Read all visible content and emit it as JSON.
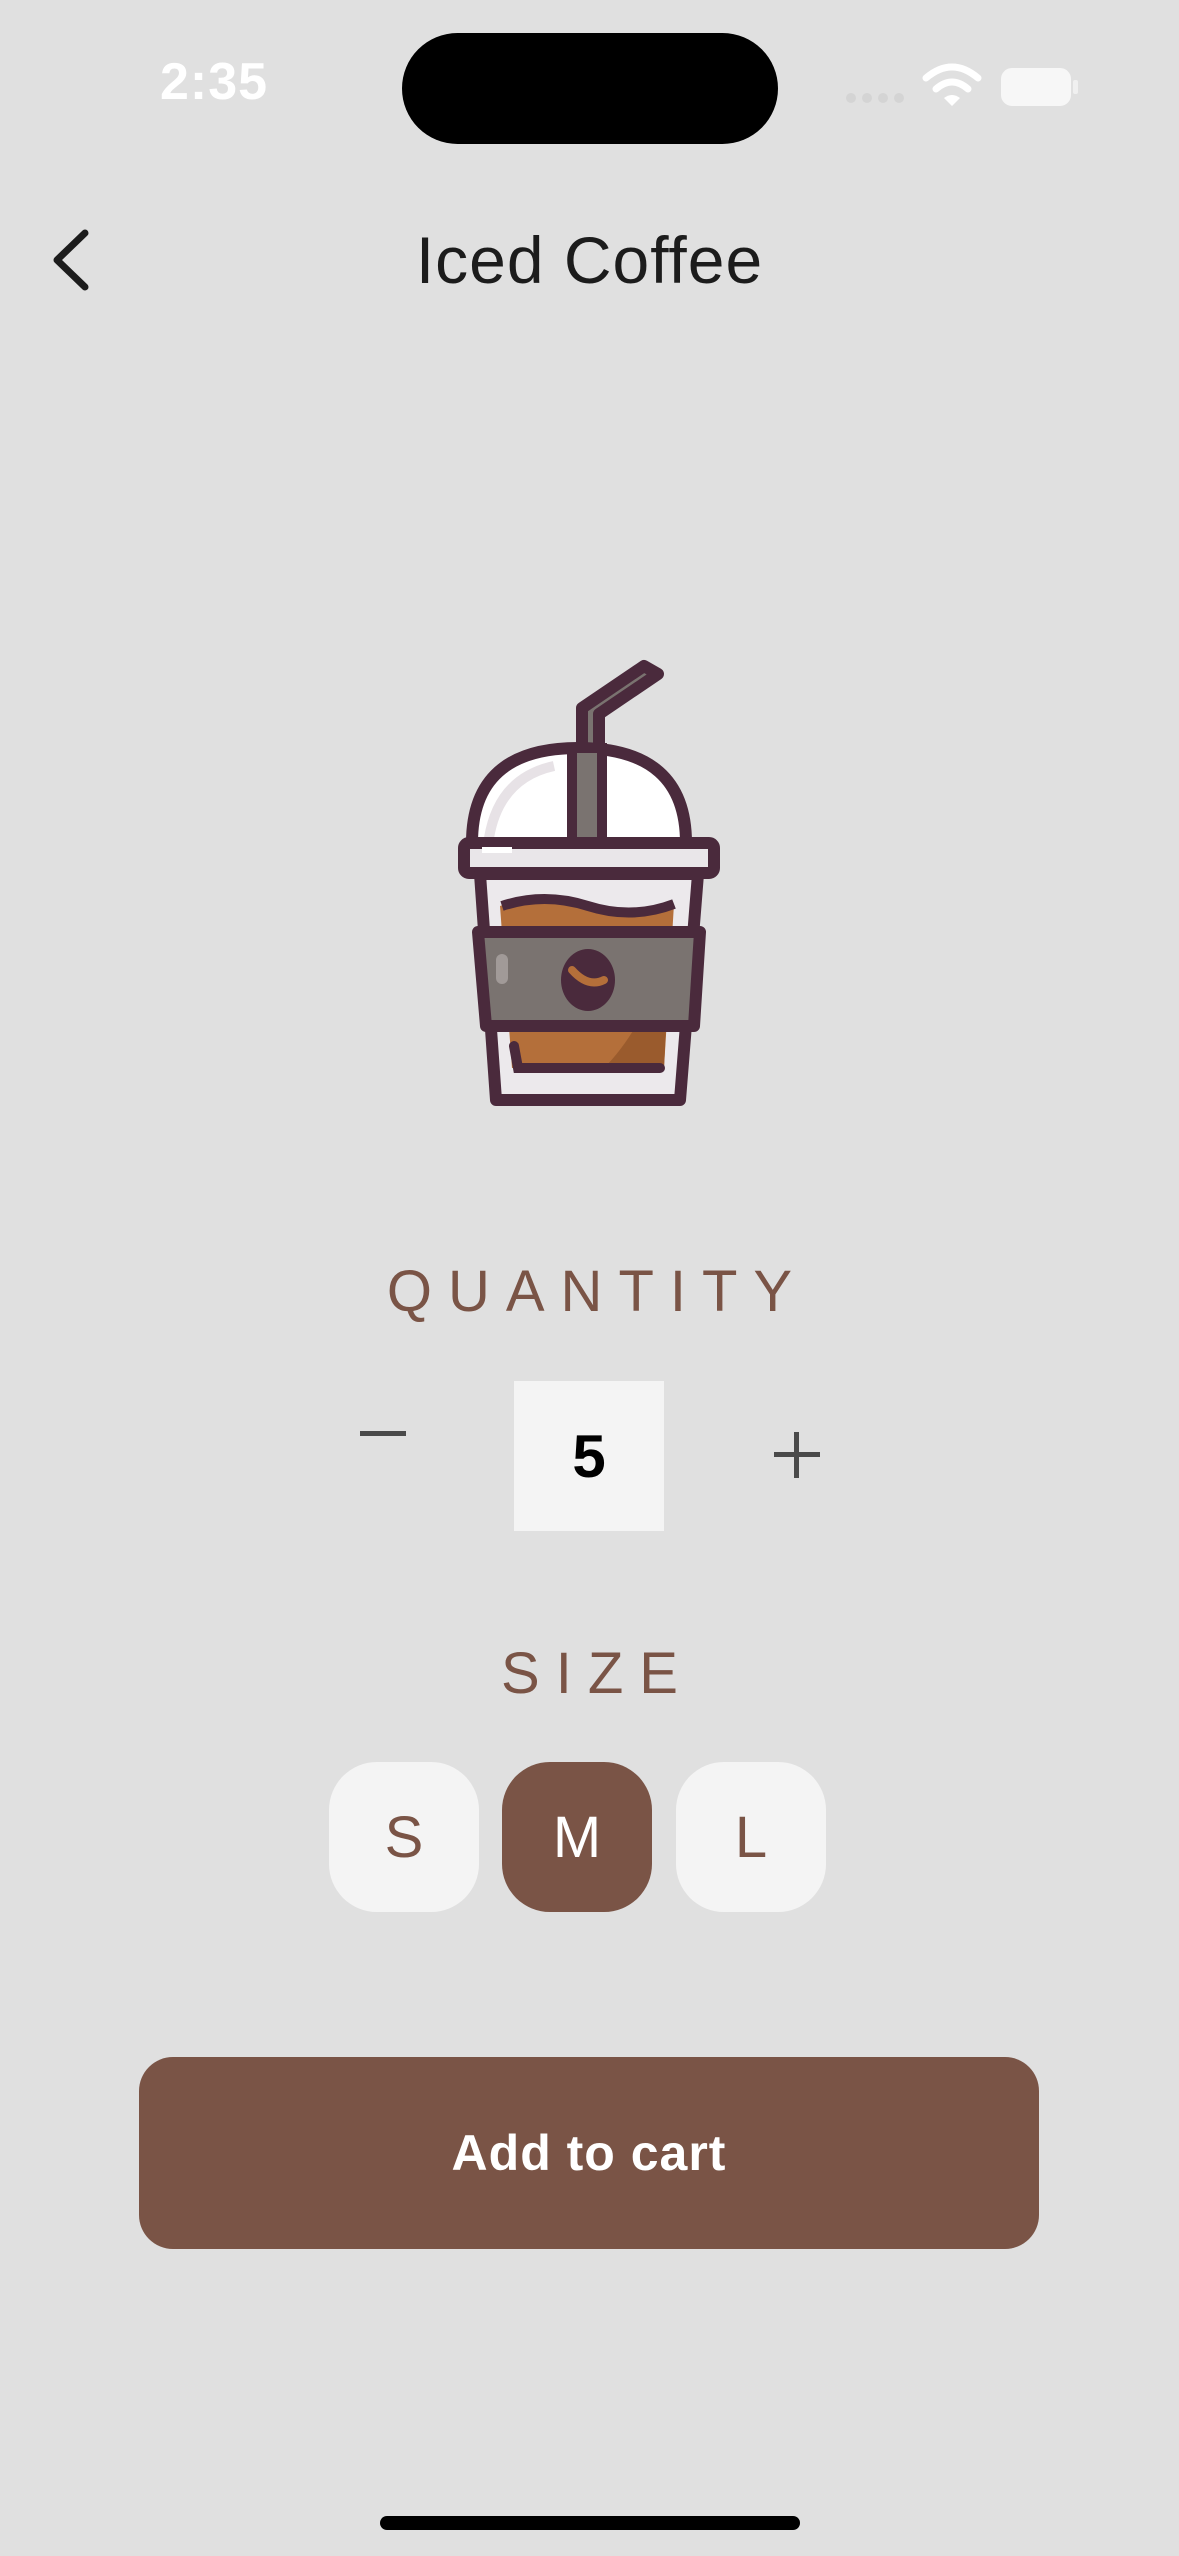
{
  "status_bar": {
    "time": "2:35",
    "icons": [
      "cellular-signal-icon",
      "wifi-icon",
      "battery-icon"
    ]
  },
  "header": {
    "back_icon": "chevron-left-icon",
    "title": "Iced Coffee"
  },
  "product": {
    "image_icon": "iced-coffee-cup-icon"
  },
  "quantity": {
    "label": "QUANTITY",
    "value": "5",
    "decrement_icon": "minus-icon",
    "increment_icon": "plus-icon"
  },
  "size": {
    "label": "SIZE",
    "options": [
      "S",
      "M",
      "L"
    ],
    "selected": "M"
  },
  "cta": {
    "label": "Add to cart"
  },
  "colors": {
    "background": "#e0e0e0",
    "accent": "#7a5446",
    "chip": "#f4f4f4"
  }
}
